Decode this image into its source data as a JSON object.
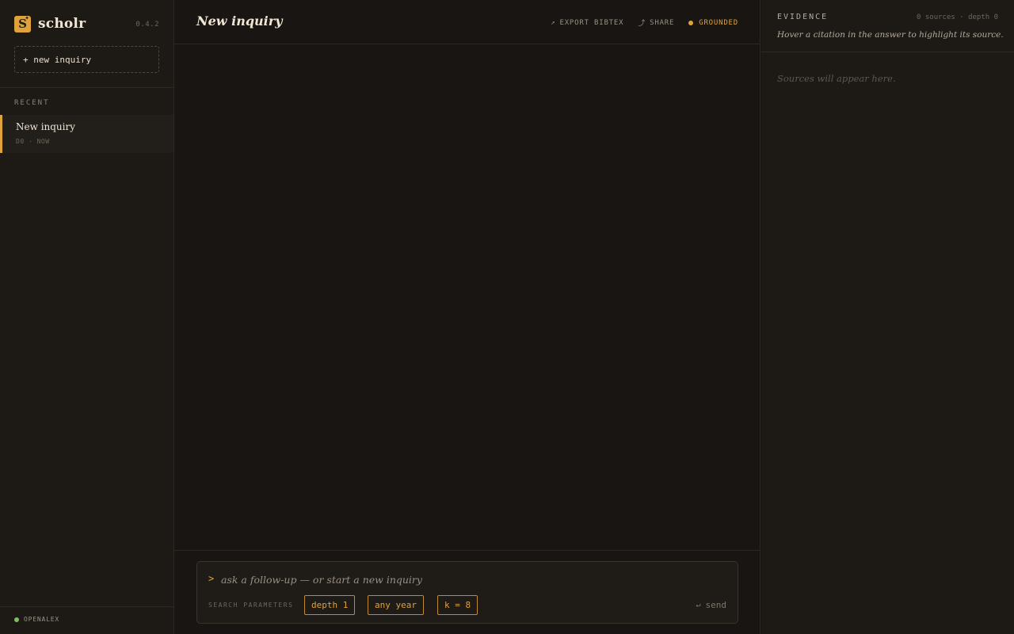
{
  "app": {
    "name": "scholr",
    "logo_letter": "S",
    "version": "0.4.2",
    "accent_color": "#e0a23a"
  },
  "sidebar": {
    "new_inquiry_label": "+ new inquiry",
    "recent_label": "RECENT",
    "recent_items": [
      {
        "title": "New inquiry",
        "meta": "D0 · NOW",
        "active": true
      }
    ],
    "source_status": {
      "label": "OPENALEX",
      "status_color": "#7fbf5e"
    }
  },
  "main": {
    "title": "New inquiry",
    "actions": {
      "export_label": "EXPORT BIBTEX",
      "export_icon": "arrow-up-right-icon",
      "share_label": "SHARE",
      "share_icon": "share-icon",
      "grounded_label": "GROUNDED"
    },
    "composer": {
      "caret": ">",
      "placeholder": "ask a follow-up — or start a new inquiry",
      "value": "",
      "params_label": "SEARCH PARAMETERS",
      "params": [
        "depth 1",
        "any year",
        "k = 8"
      ],
      "send_label": "send",
      "send_icon": "return-icon"
    }
  },
  "evidence": {
    "title": "EVIDENCE",
    "meta": "0 sources · depth 0",
    "hint": "Hover a citation in the answer to highlight its source.",
    "empty_text": "Sources will appear here."
  }
}
